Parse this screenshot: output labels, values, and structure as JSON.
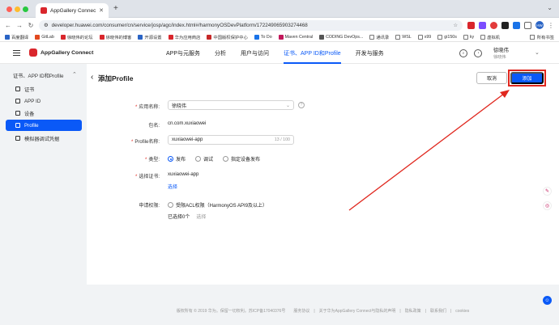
{
  "browser": {
    "tab_title": "AppGallery Connect",
    "new_tab": "+",
    "url": "developer.huawei.com/consumer/cn/service/josp/agc/index.html#/harmonyOSDevPlatform/172249065903274468",
    "profile_initials": "HW"
  },
  "bookmarks": {
    "items": [
      "百度翻译",
      "GitLab",
      "徐晓伟的论坛",
      "徐晓伟的博客",
      "开源设置",
      "华为应用商店",
      "中国版权保护中心",
      "To Do",
      "Maven Central",
      "CODING DevOps...",
      "通讯录",
      "WSL",
      "x99",
      "gi150s",
      "ky",
      "虚拟机"
    ],
    "all_bookmarks": "所有书签"
  },
  "app": {
    "brand": "AppGallery Connect",
    "nav": [
      "APP与元服务",
      "分析",
      "用户与访问",
      "证书、APP ID和Profile",
      "开发与服务"
    ],
    "active_nav": 3,
    "user_name": "徐晓伟",
    "user_sub": "徐晓伟"
  },
  "sidebar": {
    "group": "证书、APP ID和Profile",
    "items": [
      "证书",
      "APP ID",
      "设备",
      "Profile",
      "模拟器调试凭据"
    ],
    "active": 3
  },
  "page": {
    "title": "添加Profile",
    "cancel": "取消",
    "add": "添加"
  },
  "form": {
    "app_name_label": "应用名称:",
    "app_name_value": "徐晓伟",
    "package_label": "包名:",
    "package_value": "cn.com.xuxiaowei",
    "profile_label": "Profile名称:",
    "profile_value": "xuxiaowei-app",
    "profile_count": "13 / 100",
    "type_label": "类型:",
    "type_options": [
      "发布",
      "调试",
      "指定设备发布"
    ],
    "type_selected": 0,
    "cert_label": "选择证书:",
    "cert_value": "xuxiaowei-app",
    "cert_select": "选择",
    "acl_label": "申请权限:",
    "acl_text": "受限ACL权限（HarmonyOS API9及以上）",
    "selected_count": "已选择0个",
    "select_link": "选择"
  },
  "footer": "版权所有 © 2019 华为。保留一切权利。苏ICP备17040376号　　服务协议　|　关于华为AppGallery Connect与隐私的声明　|　隐私政策　|　联系我们　|　cookies"
}
